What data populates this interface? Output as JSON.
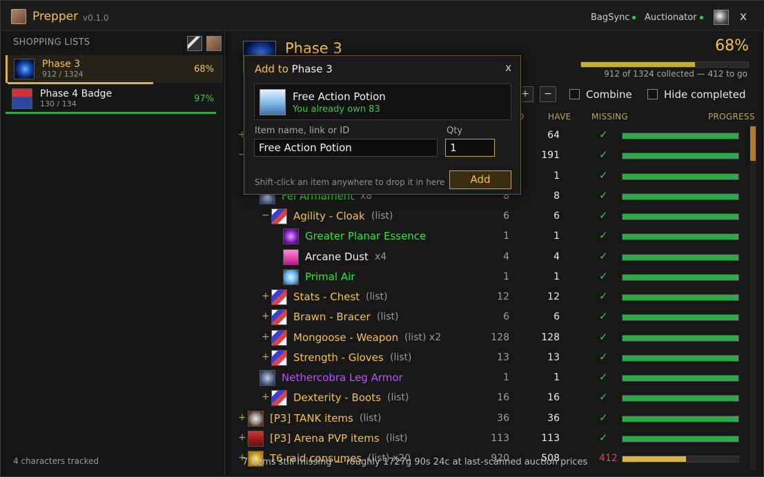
{
  "window": {
    "title": "Prepper",
    "version": "v0.1.0",
    "addons": [
      {
        "name": "BagSync",
        "status_color": "#2bd24a"
      },
      {
        "name": "Auctionator",
        "status_color": "#2bd24a"
      }
    ],
    "close_label": "x"
  },
  "sidebar": {
    "header": "SHOPPING LISTS",
    "lists": [
      {
        "name": "Phase 3",
        "count": "912 / 1324",
        "pct": "68%",
        "progress": 0.68,
        "color": "#d9b44a"
      },
      {
        "name": "Phase 4 Badge",
        "count": "130 / 134",
        "pct": "97%",
        "progress": 0.97,
        "color": "#2ea84a"
      }
    ],
    "footer": "4 characters tracked"
  },
  "main": {
    "title": "Phase 3",
    "pct": "68%",
    "progress": 0.68,
    "summary": "912 of 1324 collected — 412 to go",
    "expand_label": "+",
    "collapse_label": "−",
    "combine_label": "Combine",
    "hide_completed_label": "Hide completed",
    "columns": {
      "need": "D",
      "have": "HAVE",
      "missing": "MISSING",
      "progress": "PROGRESS"
    },
    "footer_note": "7 items still missing — roughly 1727g 90s 24c at last-scanned auction prices"
  },
  "rows": [
    {
      "indent": 0,
      "exp": "+",
      "icon": "enchant-icon",
      "cls": "ench",
      "name": "",
      "color": "gold",
      "suffix": "",
      "need": "",
      "have": "64",
      "missing": "✓",
      "progress": 1
    },
    {
      "indent": 0,
      "exp": "−",
      "icon": "enchant-icon",
      "cls": "ench",
      "name": "",
      "color": "gold",
      "suffix": "",
      "need": "",
      "have": "191",
      "missing": "✓",
      "progress": 1
    },
    {
      "indent": 1,
      "exp": "",
      "icon": "enchant-icon",
      "cls": "ench",
      "name": "",
      "color": "gold",
      "suffix": "",
      "need": "",
      "have": "1",
      "missing": "✓",
      "progress": 1
    },
    {
      "indent": 1,
      "exp": "",
      "icon": "armor-icon",
      "cls": "armor",
      "name": "Fel Armament",
      "color": "green",
      "suffix": "x8",
      "need": "8",
      "have": "8",
      "missing": "✓",
      "progress": 1
    },
    {
      "indent": 2,
      "exp": "−",
      "icon": "enchant-icon",
      "cls": "ench",
      "name": "Agility - Cloak",
      "color": "gold",
      "suffix": "(list)",
      "need": "6",
      "have": "6",
      "missing": "✓",
      "progress": 1
    },
    {
      "indent": 3,
      "exp": "",
      "icon": "essence-icon",
      "cls": "essence",
      "name": "Greater Planar Essence",
      "color": "green",
      "suffix": "",
      "need": "1",
      "have": "1",
      "missing": "✓",
      "progress": 1
    },
    {
      "indent": 3,
      "exp": "",
      "icon": "dust-icon",
      "cls": "dust",
      "name": "Arcane Dust",
      "color": "white",
      "suffix": "x4",
      "need": "4",
      "have": "4",
      "missing": "✓",
      "progress": 1
    },
    {
      "indent": 3,
      "exp": "",
      "icon": "air-icon",
      "cls": "air",
      "name": "Primal Air",
      "color": "green",
      "suffix": "",
      "need": "1",
      "have": "1",
      "missing": "✓",
      "progress": 1
    },
    {
      "indent": 2,
      "exp": "+",
      "icon": "enchant-icon",
      "cls": "ench",
      "name": "Stats - Chest",
      "color": "gold",
      "suffix": "(list)",
      "need": "12",
      "have": "12",
      "missing": "✓",
      "progress": 1
    },
    {
      "indent": 2,
      "exp": "+",
      "icon": "enchant-icon",
      "cls": "ench",
      "name": "Brawn - Bracer",
      "color": "gold",
      "suffix": "(list)",
      "need": "6",
      "have": "6",
      "missing": "✓",
      "progress": 1
    },
    {
      "indent": 2,
      "exp": "+",
      "icon": "enchant-icon",
      "cls": "ench",
      "name": "Mongoose - Weapon",
      "color": "gold",
      "suffix": "(list)  x2",
      "need": "128",
      "have": "128",
      "missing": "✓",
      "progress": 1
    },
    {
      "indent": 2,
      "exp": "+",
      "icon": "enchant-icon",
      "cls": "ench",
      "name": "Strength - Gloves",
      "color": "gold",
      "suffix": "(list)",
      "need": "13",
      "have": "13",
      "missing": "✓",
      "progress": 1
    },
    {
      "indent": 1,
      "exp": "",
      "icon": "leg-armor-icon",
      "cls": "armor",
      "name": "Nethercobra Leg Armor",
      "color": "purple",
      "suffix": "",
      "need": "1",
      "have": "1",
      "missing": "✓",
      "progress": 1
    },
    {
      "indent": 2,
      "exp": "+",
      "icon": "enchant-icon",
      "cls": "ench",
      "name": "Dexterity - Boots",
      "color": "gold",
      "suffix": "(list)",
      "need": "16",
      "have": "16",
      "missing": "✓",
      "progress": 1
    },
    {
      "indent": 0,
      "exp": "+",
      "icon": "shield-icon",
      "cls": "shield",
      "name": "[P3] TANK items",
      "color": "gold",
      "suffix": "(list)",
      "need": "36",
      "have": "36",
      "missing": "✓",
      "progress": 1
    },
    {
      "indent": 0,
      "exp": "+",
      "icon": "pvp-icon",
      "cls": "pvp",
      "name": "[P3] Arena PVP items",
      "color": "gold",
      "suffix": "(list)",
      "need": "113",
      "have": "113",
      "missing": "✓",
      "progress": 1
    },
    {
      "indent": 0,
      "exp": "+",
      "icon": "gold-icon",
      "cls": "gold",
      "name": "T6 raid consumes",
      "color": "gold",
      "suffix": "(list)  x20",
      "need": "920",
      "have": "508",
      "missing": "412",
      "progress": 0.55
    }
  ],
  "dialog": {
    "title_prefix": "Add to",
    "title_target": "Phase 3",
    "close_label": "x",
    "item_name": "Free Action Potion",
    "item_owned": "You already own 83",
    "name_label": "Item name, link or ID",
    "name_value": "Free Action Potion",
    "qty_label": "Qty",
    "qty_value": "1",
    "hint": "Shift-click an item anywhere to drop it in here",
    "add_label": "Add"
  }
}
